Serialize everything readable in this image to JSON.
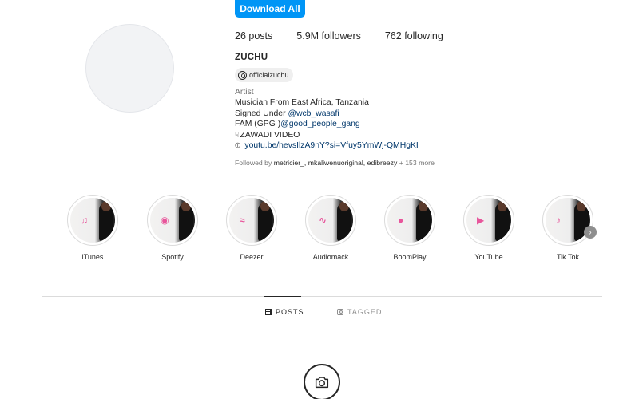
{
  "header": {
    "download_label": "Download All"
  },
  "profile": {
    "stats": {
      "posts": "26 posts",
      "followers": "5.9M followers",
      "following": "762 following"
    },
    "username": "ZUCHU",
    "threads_handle": "officialzuchu",
    "bio": {
      "category": "Artist",
      "line1": "Musician From East Africa, Tanzania",
      "line2_prefix": "Signed Under ",
      "line2_mention": "@wcb_wasafi",
      "line3_prefix": "FAM (GPG )",
      "line3_mention": "@good_people_gang",
      "line4": "ZAWADI VIDEO",
      "link": "youtu.be/hevsIlzA9nY?si=Vfuy5YmWj-QMHgKI"
    },
    "followed_by": {
      "prefix": "Followed by ",
      "names": "metricier_, mkaliwenuoriginal, edibreezy",
      "suffix": " + 153 more"
    }
  },
  "highlights": [
    {
      "label": "iTunes",
      "icon": "music-note-icon",
      "glyph": "♫"
    },
    {
      "label": "Spotify",
      "icon": "spotify-icon",
      "glyph": "◉"
    },
    {
      "label": "Deezer",
      "icon": "deezer-icon",
      "glyph": "≈"
    },
    {
      "label": "Audiomack",
      "icon": "audiomack-icon",
      "glyph": "∿"
    },
    {
      "label": "BoomPlay",
      "icon": "boomplay-icon",
      "glyph": "●"
    },
    {
      "label": "YouTube",
      "icon": "youtube-icon",
      "glyph": "▶"
    },
    {
      "label": "Tik Tok",
      "icon": "tiktok-icon",
      "glyph": "♪"
    }
  ],
  "tabs": {
    "posts": "POSTS",
    "tagged": "TAGGED"
  },
  "colors": {
    "accent": "#0095f6",
    "highlight_icon": "#e8559b",
    "link": "#00376b"
  }
}
